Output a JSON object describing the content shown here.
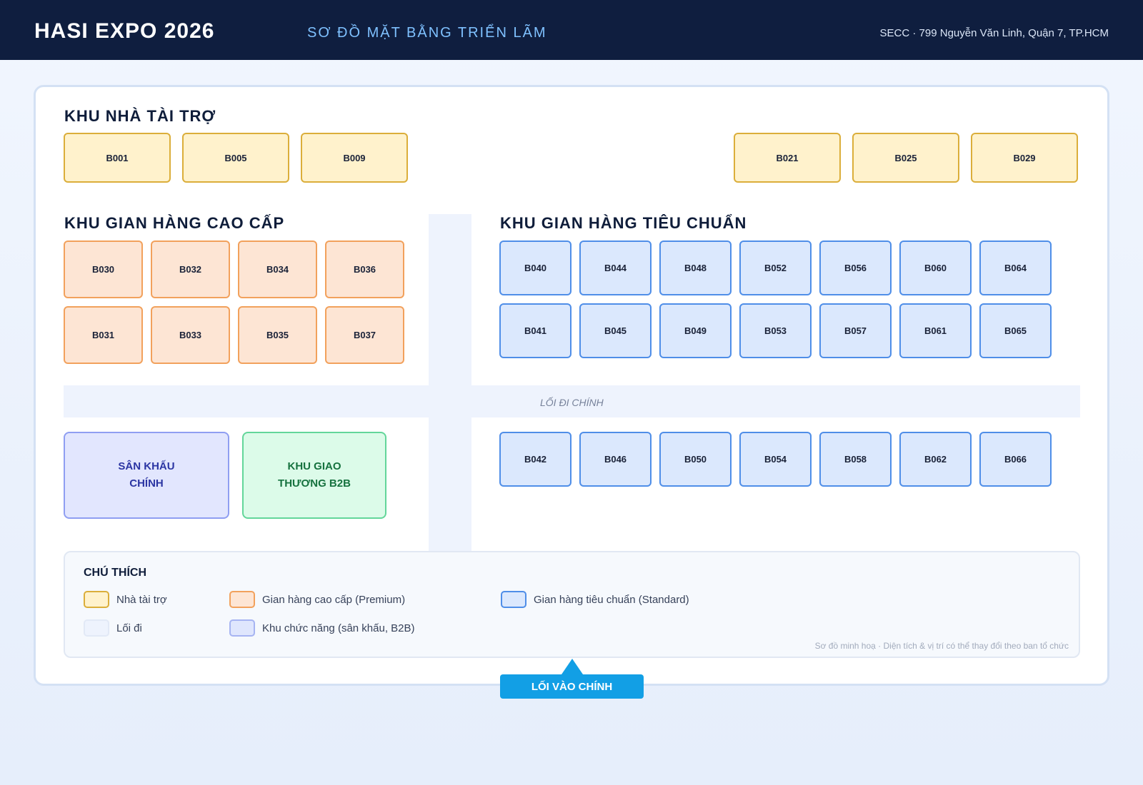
{
  "header": {
    "brand": "HASI EXPO 2026",
    "subtitle": "SƠ ĐỒ MẶT BẰNG TRIỂN LÃM",
    "venue": "SECC · 799 Nguyễn Văn Linh, Quận 7, TP.HCM"
  },
  "zones": {
    "sponsor": {
      "title": "KHU NHÀ TÀI TRỢ",
      "booths_left": [
        "B001",
        "B005",
        "B009"
      ],
      "booths_right": [
        "B021",
        "B025",
        "B029"
      ]
    },
    "premium": {
      "title": "KHU GIAN HÀNG CAO CẤP",
      "row1": [
        "B030",
        "B032",
        "B034",
        "B036"
      ],
      "row2": [
        "B031",
        "B033",
        "B035",
        "B037"
      ]
    },
    "standard": {
      "title": "KHU GIAN HÀNG TIÊU CHUẨN",
      "row1": [
        "B040",
        "B044",
        "B048",
        "B052",
        "B056",
        "B060",
        "B064"
      ],
      "row2": [
        "B041",
        "B045",
        "B049",
        "B053",
        "B057",
        "B061",
        "B065"
      ],
      "row3": [
        "B042",
        "B046",
        "B050",
        "B054",
        "B058",
        "B062",
        "B066"
      ]
    }
  },
  "aisle_label": "LỐI ĐI CHÍNH",
  "functional": {
    "stage_line1": "SÂN KHẤU",
    "stage_line2": "CHÍNH",
    "b2b_line1": "KHU GIAO",
    "b2b_line2": "THƯƠNG B2B"
  },
  "legend": {
    "title": "CHÚ THÍCH",
    "sponsor": "Nhà tài trợ",
    "premium": "Gian hàng cao cấp (Premium)",
    "standard": "Gian hàng tiêu chuẩn (Standard)",
    "aisle": "Lối đi",
    "functional": "Khu chức năng (sân khấu, B2B)",
    "note": "Sơ đồ minh hoạ · Diện tích & vị trí có thể thay đổi theo ban tổ chức"
  },
  "entrance": "LỐI VÀO CHÍNH",
  "colors": {
    "header_bg": "#0f1e3f",
    "sponsor_fill": "#fff2cc",
    "sponsor_border": "#dbae3a",
    "premium_fill": "#fde5d4",
    "premium_border": "#f2a15c",
    "standard_fill": "#dbe8fd",
    "standard_border": "#4f8ee8",
    "aisle_fill": "#eef3fd",
    "entrance": "#129fe5"
  }
}
